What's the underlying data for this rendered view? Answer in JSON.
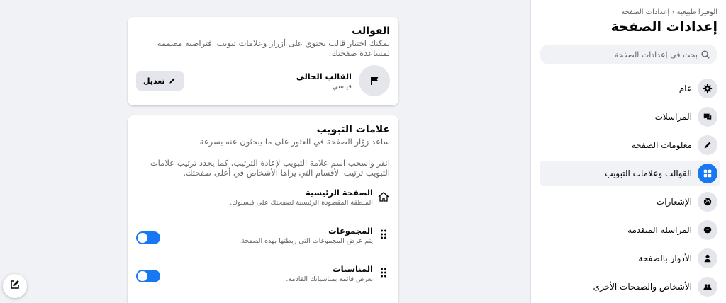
{
  "sidebar": {
    "breadcrumb": "الوفيرا طبيعية ‹ إعدادات الصفحة",
    "title": "إعدادات الصفحة",
    "search_placeholder": "بحث في إعدادات الصفحة",
    "items": [
      {
        "label": "عام",
        "icon": "gear-icon",
        "active": false
      },
      {
        "label": "المراسلات",
        "icon": "chat-icon",
        "active": false
      },
      {
        "label": "معلومات الصفحة",
        "icon": "pencil-icon",
        "active": false
      },
      {
        "label": "القوالب وعلامات التبويب",
        "icon": "grid-icon",
        "active": true
      },
      {
        "label": "الإشعارات",
        "icon": "globe-icon",
        "active": false
      },
      {
        "label": "المراسلة المتقدمة",
        "icon": "messenger-icon",
        "active": false
      },
      {
        "label": "الأدوار بالصفحة",
        "icon": "person-icon",
        "active": false
      },
      {
        "label": "الأشخاص والصفحات الأخرى",
        "icon": "people-icon",
        "active": false
      }
    ],
    "accent": "#1877f2"
  },
  "templates": {
    "title": "القوالب",
    "description": "يمكنك اختيار قالب يحتوي على أزرار وعلامات تبويب افتراضية مصممة لمساعدة صفحتك.",
    "current_label": "القالب الحالي",
    "current_value": "قياسي",
    "edit_label": "تعديل"
  },
  "tabs": {
    "title": "علامات التبويب",
    "subtitle": "ساعد زوّار الصفحة في العثور على ما يبحثون عنه بسرعة",
    "instructions": "انقر واسحب اسم علامة التبويب لإعادة الترتيب. كما يحدد ترتيب علامات التبويب ترتيب الأقسام التي يراها الأشخاص في أعلى صفحتك.",
    "items": [
      {
        "name": "الصفحة الرئيسية",
        "description": "المنطقة المقصودة الرئيسية لصفحتك على فيسبوك.",
        "lead": "home-icon",
        "toggle": false
      },
      {
        "name": "المجموعات",
        "description": "يتم عرض المجموعات التي ربطتها بهذه الصفحة.",
        "lead": "drag-handle-icon",
        "toggle": true
      },
      {
        "name": "المناسبات",
        "description": "تعرض قائمة بمناسباتك القادمة.",
        "lead": "drag-handle-icon",
        "toggle": true
      }
    ]
  }
}
